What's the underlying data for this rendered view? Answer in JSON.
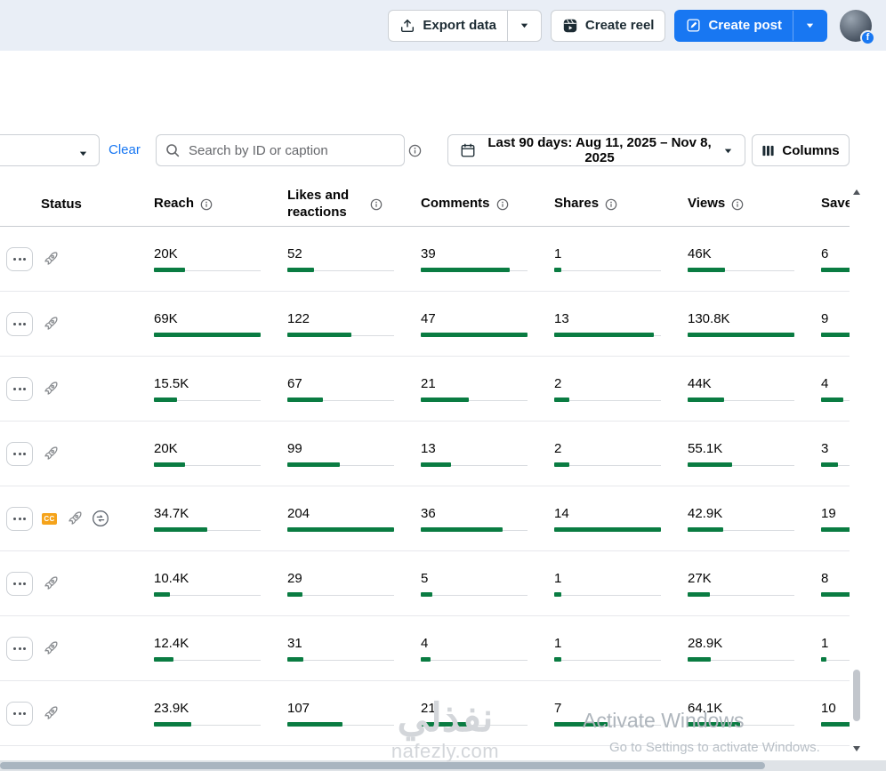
{
  "topbar": {
    "export_label": "Export data",
    "create_reel_label": "Create reel",
    "create_post_label": "Create post"
  },
  "filters": {
    "clear_label": "Clear",
    "search_placeholder": "Search by ID or caption",
    "date_range_label": "Last 90 days: Aug 11, 2025 – Nov 8, 2025",
    "columns_label": "Columns"
  },
  "table": {
    "status_header": "Status",
    "metric_columns": [
      "Reach",
      "Likes and reactions",
      "Comments",
      "Shares",
      "Views",
      "Saves"
    ],
    "rows": [
      {
        "icons": [
          "boost"
        ],
        "metrics": [
          {
            "v": "20K",
            "pct": 29
          },
          {
            "v": "52",
            "pct": 25
          },
          {
            "v": "39",
            "pct": 83
          },
          {
            "v": "1",
            "pct": 7
          },
          {
            "v": "46K",
            "pct": 35
          },
          {
            "v": "6",
            "pct": 32
          }
        ]
      },
      {
        "icons": [
          "boost"
        ],
        "metrics": [
          {
            "v": "69K",
            "pct": 100
          },
          {
            "v": "122",
            "pct": 60
          },
          {
            "v": "47",
            "pct": 100
          },
          {
            "v": "13",
            "pct": 93
          },
          {
            "v": "130.8K",
            "pct": 100
          },
          {
            "v": "9",
            "pct": 47
          }
        ]
      },
      {
        "icons": [
          "boost"
        ],
        "metrics": [
          {
            "v": "15.5K",
            "pct": 22
          },
          {
            "v": "67",
            "pct": 33
          },
          {
            "v": "21",
            "pct": 45
          },
          {
            "v": "2",
            "pct": 14
          },
          {
            "v": "44K",
            "pct": 34
          },
          {
            "v": "4",
            "pct": 21
          }
        ]
      },
      {
        "icons": [
          "boost"
        ],
        "metrics": [
          {
            "v": "20K",
            "pct": 29
          },
          {
            "v": "99",
            "pct": 49
          },
          {
            "v": "13",
            "pct": 28
          },
          {
            "v": "2",
            "pct": 14
          },
          {
            "v": "55.1K",
            "pct": 42
          },
          {
            "v": "3",
            "pct": 16
          }
        ]
      },
      {
        "icons": [
          "cc",
          "boost",
          "refresh"
        ],
        "metrics": [
          {
            "v": "34.7K",
            "pct": 50
          },
          {
            "v": "204",
            "pct": 100
          },
          {
            "v": "36",
            "pct": 77
          },
          {
            "v": "14",
            "pct": 100
          },
          {
            "v": "42.9K",
            "pct": 33
          },
          {
            "v": "19",
            "pct": 100
          }
        ]
      },
      {
        "icons": [
          "boost"
        ],
        "metrics": [
          {
            "v": "10.4K",
            "pct": 15
          },
          {
            "v": "29",
            "pct": 14
          },
          {
            "v": "5",
            "pct": 11
          },
          {
            "v": "1",
            "pct": 7
          },
          {
            "v": "27K",
            "pct": 21
          },
          {
            "v": "8",
            "pct": 42
          }
        ]
      },
      {
        "icons": [
          "boost"
        ],
        "metrics": [
          {
            "v": "12.4K",
            "pct": 18
          },
          {
            "v": "31",
            "pct": 15
          },
          {
            "v": "4",
            "pct": 9
          },
          {
            "v": "1",
            "pct": 7
          },
          {
            "v": "28.9K",
            "pct": 22
          },
          {
            "v": "1",
            "pct": 5
          }
        ]
      },
      {
        "icons": [
          "boost"
        ],
        "metrics": [
          {
            "v": "23.9K",
            "pct": 35
          },
          {
            "v": "107",
            "pct": 52
          },
          {
            "v": "21",
            "pct": 45
          },
          {
            "v": "7",
            "pct": 50
          },
          {
            "v": "64.1K",
            "pct": 49
          },
          {
            "v": "10",
            "pct": 53
          }
        ]
      }
    ]
  },
  "watermark": {
    "arabic": "نفذلي",
    "domain": "nafezly.com"
  },
  "activate": {
    "line1": "Activate Windows",
    "line2": "Go to Settings to activate Windows."
  },
  "colors": {
    "accent_green": "#0a7c42",
    "brand_blue": "#1877f2",
    "topbar_bg": "#e9eef6"
  }
}
